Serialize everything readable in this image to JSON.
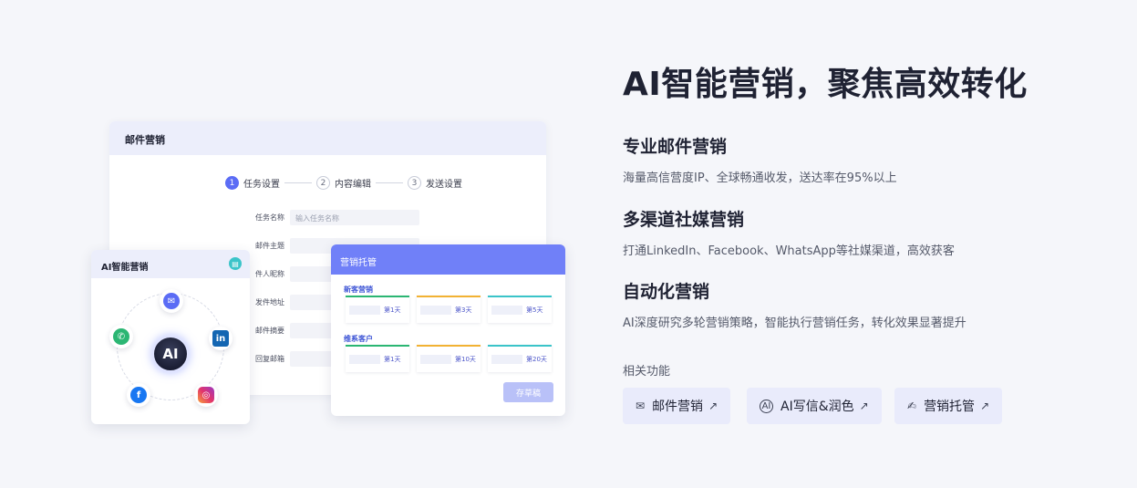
{
  "email_card": {
    "title": "邮件营销",
    "steps": [
      {
        "num": "1",
        "label": "任务设置"
      },
      {
        "num": "2",
        "label": "内容编辑"
      },
      {
        "num": "3",
        "label": "发送设置"
      }
    ],
    "fields": [
      {
        "label": "任务名称",
        "placeholder": "输入任务名称"
      },
      {
        "label": "邮件主题",
        "placeholder": ""
      },
      {
        "label": "件人昵称",
        "placeholder": ""
      },
      {
        "label": "发件地址",
        "placeholder": ""
      },
      {
        "label": "邮件摘要",
        "placeholder": ""
      },
      {
        "label": "回复邮箱",
        "placeholder": ""
      }
    ]
  },
  "ai_card": {
    "title": "AI智能营销",
    "center_label": "AI",
    "channels": [
      "mail-icon",
      "whatsapp-icon",
      "linkedin-icon",
      "facebook-icon",
      "instagram-icon"
    ],
    "linkedin_text": "in",
    "facebook_text": "f"
  },
  "host_card": {
    "title": "营销托管",
    "groups": [
      {
        "title": "新客营销",
        "days": [
          "第1天",
          "第3天",
          "第5天"
        ]
      },
      {
        "title": "维系客户",
        "days": [
          "第1天",
          "第10天",
          "第20天"
        ]
      }
    ],
    "draft_label": "存草稿"
  },
  "main": {
    "title": "AI智能营销，聚焦高效转化",
    "features": [
      {
        "heading": "专业邮件营销",
        "desc": "海量高信营度IP、全球畅通收发，送达率在95%以上"
      },
      {
        "heading": "多渠道社媒营销",
        "desc": "打通LinkedIn、Facebook、WhatsApp等社媒渠道，高效获客"
      },
      {
        "heading": "自动化营销",
        "desc": "AI深度研究多轮营销策略，智能执行营销任务，转化效果显著提升"
      }
    ],
    "related_label": "相关功能",
    "related_buttons": [
      {
        "label": "邮件营销",
        "icon": "envelope-icon"
      },
      {
        "label": "AI写信&润色",
        "icon": "ai-icon"
      },
      {
        "label": "营销托管",
        "icon": "hand-icon"
      }
    ]
  },
  "colors": {
    "accent": "#5b6cf5",
    "host_header": "#7080f8",
    "green": "#2bb673",
    "orange": "#f2b233",
    "teal": "#3bc4c9"
  }
}
